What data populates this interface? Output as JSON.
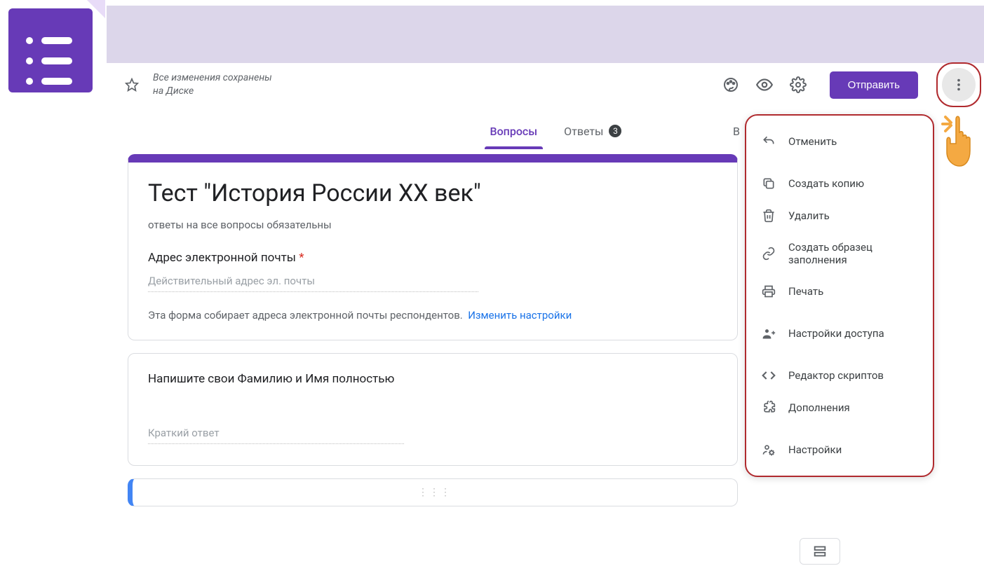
{
  "app": {
    "name": "Google Forms"
  },
  "header": {
    "save_status_line1": "Все изменения сохранены",
    "save_status_line2": "на Диске",
    "send_button": "Отправить"
  },
  "tabs": {
    "questions": "Вопросы",
    "answers": "Ответы",
    "answers_count": "3",
    "total_partial": "В"
  },
  "form": {
    "title": "Тест \"История России XX век\"",
    "description": "ответы на все вопросы обязательны",
    "email_label": "Адрес электронной почты",
    "email_placeholder": "Действительный адрес эл. почты",
    "collect_note": "Эта форма собирает адреса электронной почты респондентов.",
    "change_settings": "Изменить настройки",
    "question1": "Напишите свои Фамилию и Имя полностью",
    "short_answer": "Краткий ответ"
  },
  "menu": {
    "undo": "Отменить",
    "copy": "Создать копию",
    "delete": "Удалить",
    "prefill": "Создать образец заполнения",
    "print": "Печать",
    "collaborators": "Настройки доступа",
    "script_editor": "Редактор скриптов",
    "addons": "Дополнения",
    "settings": "Настройки"
  }
}
